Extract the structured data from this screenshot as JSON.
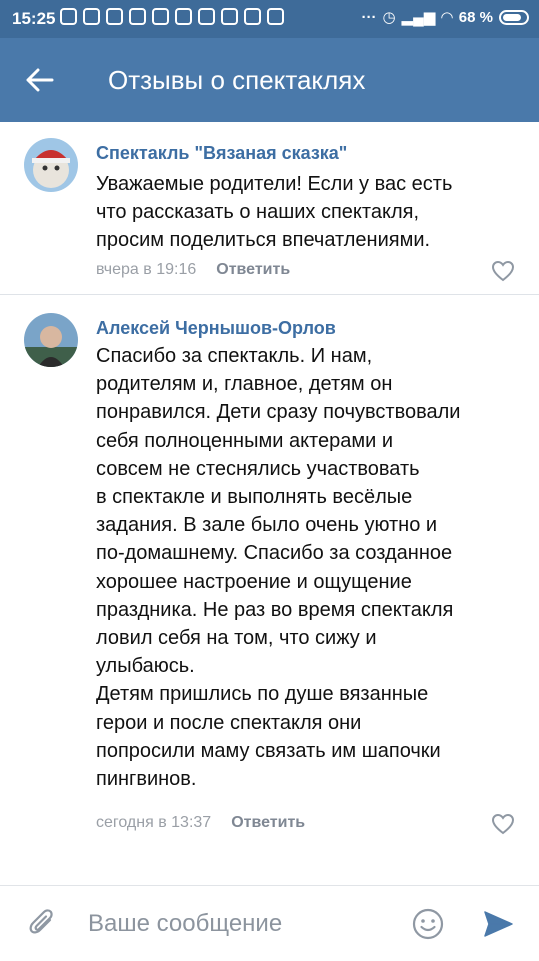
{
  "status_bar": {
    "time": "15:25",
    "battery": "68 %"
  },
  "app_bar": {
    "title": "Отзывы о спектаклях",
    "back_icon": "arrow-left-icon"
  },
  "comments": [
    {
      "author": "Спектакль \"Вязаная сказка\"",
      "text": "Уважаемые родители! Если у вас есть\nчто рассказать о наших спектакля,\nпросим поделиться впечатлениями.",
      "time": "вчера в 19:16",
      "reply_label": "Ответить"
    },
    {
      "author": "Алексей Чернышов-Орлов",
      "text": "Спасибо за спектакль. И нам,\nродителям и, главное, детям он\nпонравился. Дети сразу почувствовали\nсебя полноценными актерами и\nсовсем не стеснялись участвовать\nв спектакле и выполнять весёлые\nзадания. В зале было очень уютно и\nпо-домашнему. Спасибо за созданное\nхорошее настроение и ощущение\nпраздника. Не раз во время спектакля\nловил себя на том, что сижу и\nулыбаюсь.\nДетям пришлись по душе вязанные\nгерои и после спектакля они\nпопросили маму связать им шапочки\nпингвинов.",
      "time": "сегодня в 13:37",
      "reply_label": "Ответить"
    }
  ],
  "composer": {
    "placeholder": "Ваше сообщение"
  },
  "colors": {
    "status_bar": "#3e6b99",
    "app_bar": "#4a79aa",
    "author_link": "#3d6ea3",
    "send_icon": "#4a79aa"
  }
}
